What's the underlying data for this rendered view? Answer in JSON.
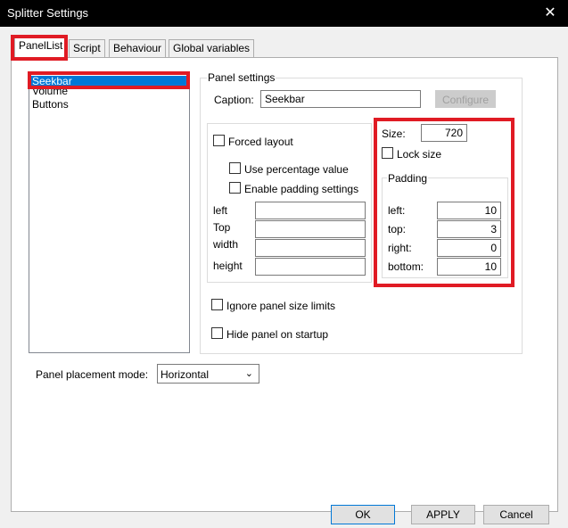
{
  "window": {
    "title": "Splitter Settings",
    "close": "✕"
  },
  "tabs": [
    "PanelList",
    "Script",
    "Behaviour",
    "Global variables"
  ],
  "panel_list": {
    "items": [
      "Seekbar",
      "Volume",
      "Buttons"
    ],
    "selected": "Seekbar"
  },
  "panel_settings": {
    "group_label": "Panel settings",
    "caption_label": "Caption:",
    "caption_value": "Seekbar",
    "configure_label": "Configure"
  },
  "forced": {
    "forced_layout_label": "Forced layout",
    "use_percentage_label": "Use percentage value",
    "enable_padding_label": "Enable padding settings",
    "left_label": "left",
    "top_label": "Top",
    "width_label": "width",
    "height_label": "height"
  },
  "size": {
    "size_label": "Size:",
    "size_value": "720",
    "lock_label": "Lock size",
    "padding_label": "Padding",
    "left_label": "left:",
    "left_value": "10",
    "top_label": "top:",
    "top_value": "3",
    "right_label": "right:",
    "right_value": "0",
    "bottom_label": "bottom:",
    "bottom_value": "10"
  },
  "options": {
    "ignore_limits_label": "Ignore panel size limits",
    "hide_startup_label": "Hide panel on startup"
  },
  "placement": {
    "label": "Panel placement mode:",
    "value": "Horizontal"
  },
  "buttons": {
    "ok": "OK",
    "apply": "APPLY",
    "cancel": "Cancel"
  },
  "colors": {
    "highlight": "#e01b24",
    "selection": "#0078d7"
  }
}
